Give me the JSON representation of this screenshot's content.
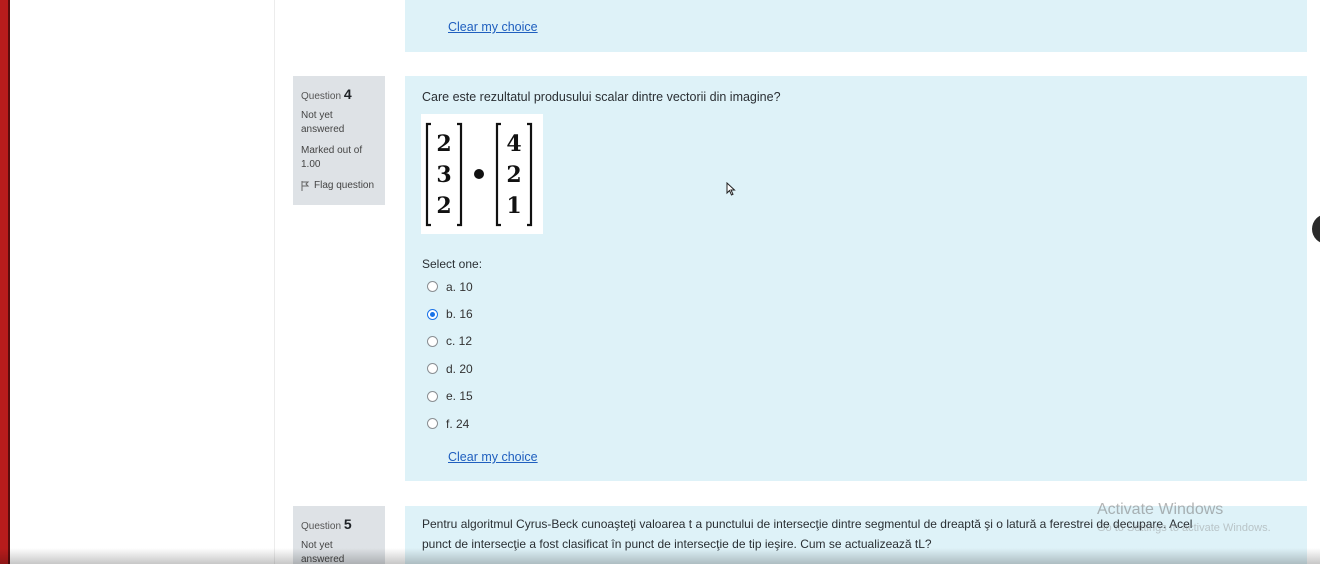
{
  "question3": {
    "clear_choice": "Clear my choice"
  },
  "question4": {
    "label": "Question",
    "number": "4",
    "state": "Not yet answered",
    "grade": "Marked out of 1.00",
    "flag": "Flag question",
    "text": "Care este rezultatul produsului scalar dintre vectorii din imagine?",
    "vector_a": [
      "2",
      "3",
      "2"
    ],
    "vector_b": [
      "4",
      "2",
      "1"
    ],
    "select_label": "Select one:",
    "options": [
      {
        "label": "a. 10",
        "checked": false
      },
      {
        "label": "b. 16",
        "checked": true
      },
      {
        "label": "c. 12",
        "checked": false
      },
      {
        "label": "d. 20",
        "checked": false
      },
      {
        "label": "e. 15",
        "checked": false
      },
      {
        "label": "f. 24",
        "checked": false
      }
    ],
    "clear_choice": "Clear my choice"
  },
  "question5": {
    "label": "Question",
    "number": "5",
    "state": "Not yet answered",
    "text_line1": "Pentru algoritmul Cyrus-Beck cunoaşteţi valoarea t a punctului de intersecţie dintre segmentul de dreaptă şi o latură a ferestrei de decupare. Acel",
    "text_line2": "punct de intersecţie a fost clasificat în punct de intersecţie de tip ieşire. Cum se actualizează tL?"
  },
  "watermark": {
    "title": "Activate Windows",
    "subtitle": "Go to Settings to activate Windows."
  },
  "colors": {
    "accent": "#1a73e8",
    "panel": "#def2f8",
    "info_box": "#dee2e6",
    "link": "#1f5fbf"
  }
}
